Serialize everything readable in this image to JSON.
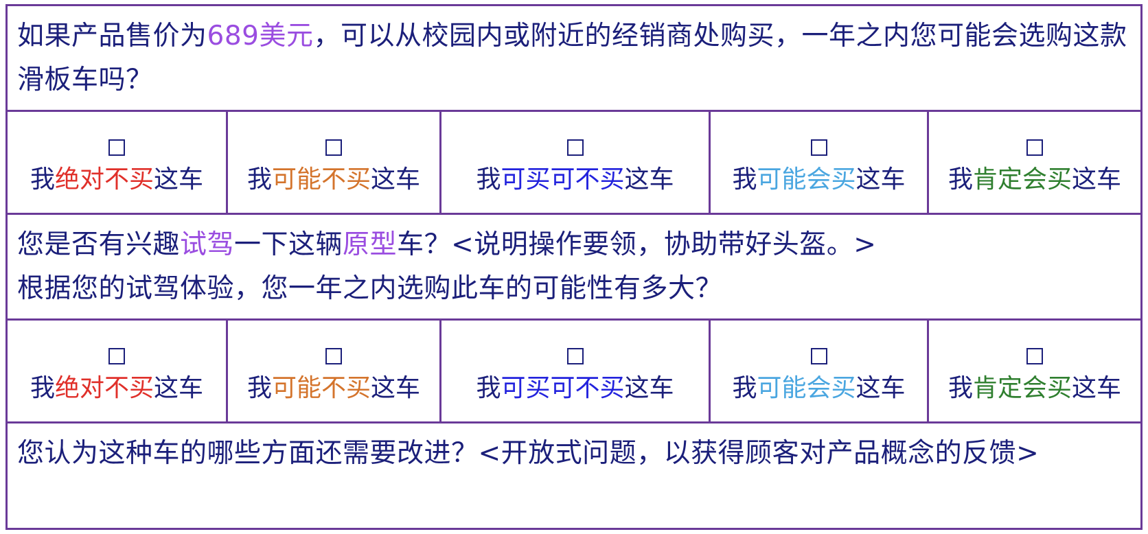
{
  "q1": {
    "before": "如果产品售价为",
    "highlight": "689美元",
    "after": "，可以从校园内或附近的经销商处购买，一年之内您可能会选购这款滑板车吗？"
  },
  "options": [
    {
      "prefix": "我",
      "colored": "绝对不买",
      "suffix": "这车",
      "color": "#e0302a"
    },
    {
      "prefix": "我",
      "colored": "可能不买",
      "suffix": "这车",
      "color": "#d4742c"
    },
    {
      "prefix": "我",
      "colored": "可买可不买",
      "suffix": "这车",
      "color": "#2222dd"
    },
    {
      "prefix": "我",
      "colored": "可能会买",
      "suffix": "这车",
      "color": "#4aa6e0"
    },
    {
      "prefix": "我",
      "colored": "肯定会买",
      "suffix": "这车",
      "color": "#2f7f2f"
    }
  ],
  "q2": {
    "part1": "您是否有兴趣",
    "highlight1": "试驾",
    "part2": "一下这辆",
    "highlight2": "原型",
    "part3": "车？<说明操作要领，协助带好头盔。>",
    "line2": "根据您的试驾体验，您一年之内选购此车的可能性有多大？"
  },
  "q3": {
    "text": "您认为这种车的哪些方面还需要改进？<开放式问题，以获得顾客对产品概念的反馈>"
  },
  "colors": {
    "border": "#6a3a98",
    "text": "#1b1f7a",
    "highlight": "#9a4de0"
  }
}
